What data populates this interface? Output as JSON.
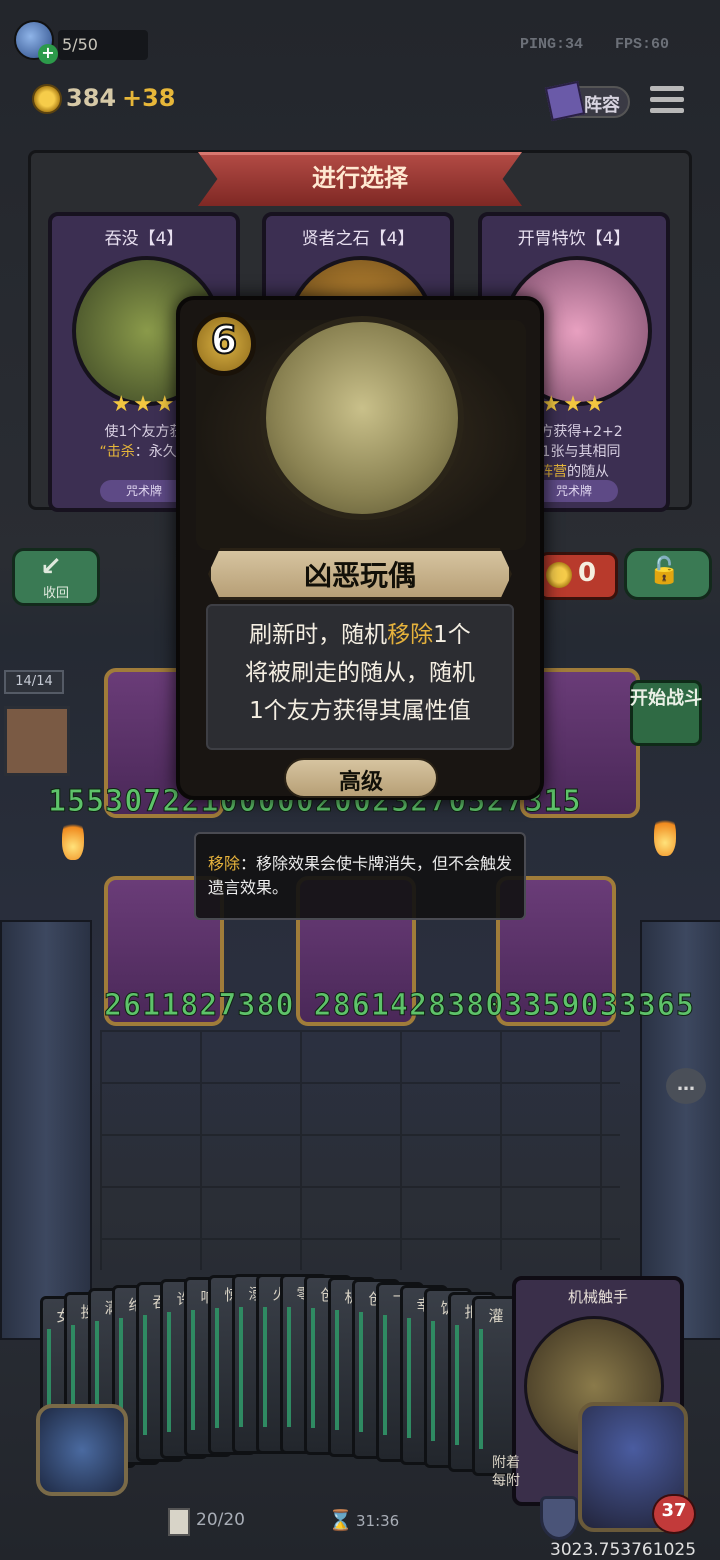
{
  "hud": {
    "board_count": "5/50",
    "ping": "PING:34",
    "fps": "FPS:60",
    "gold": "384",
    "gold_income": "+38",
    "lineup_label": "阵容"
  },
  "choice": {
    "title": "进行选择",
    "options": [
      {
        "title": "吞没【4】",
        "desc_line1": "使1个友方获",
        "desc_prefix": "“击杀",
        "desc_suffix": "：永久+",
        "type": "咒术牌",
        "stars": "★★★",
        "art_color": "#6a7a3a"
      },
      {
        "title": "贤者之石【4】",
        "art_color": "#8a6a2a"
      },
      {
        "title": "开胃特饮【4】",
        "desc_line1": "友方获得+2+2",
        "desc_line2": "得1张与其相同",
        "desc_hl": "阵营",
        "desc_line3": "的随从",
        "type": "咒术牌",
        "stars": "★★★",
        "art_color": "#c86a9a"
      }
    ]
  },
  "buttons": {
    "recycle_label": "收回",
    "refresh_cost": "0",
    "start_battle": "开始战斗"
  },
  "board": {
    "unit_count": "14/14",
    "top_numbers": "1553072210000020023270527315",
    "top_numbers_right": "7315",
    "bottom_numbers": "2611827380 28614283803359033365"
  },
  "popup": {
    "cost": "6",
    "name": "凶恶玩偶",
    "desc_line1_a": "刷新时，随机",
    "desc_line1_kw": "移除",
    "desc_line1_b": "1个",
    "desc_line2": "将被刷走的随从，随机",
    "desc_line3": "1个友方获得其属性值",
    "tier": "高级"
  },
  "tooltip": {
    "keyword": "移除",
    "text": "：移除效果会使卡牌消失，但不会触发遗言效果。"
  },
  "hand": {
    "cards": [
      "女",
      "投",
      "满",
      "络",
      "吞",
      "许",
      "响",
      "惊",
      "溺",
      "火",
      "零",
      "创",
      "机",
      "创",
      "飞",
      "幸",
      "饥",
      "扣",
      "灌"
    ],
    "featured_title": "机械触手",
    "featured_desc_line1": "附着",
    "featured_desc_line2": "每附"
  },
  "footer": {
    "deck_count": "20/20",
    "timer": "31:36",
    "health": "37",
    "coord_readout": "3023.753761025"
  }
}
